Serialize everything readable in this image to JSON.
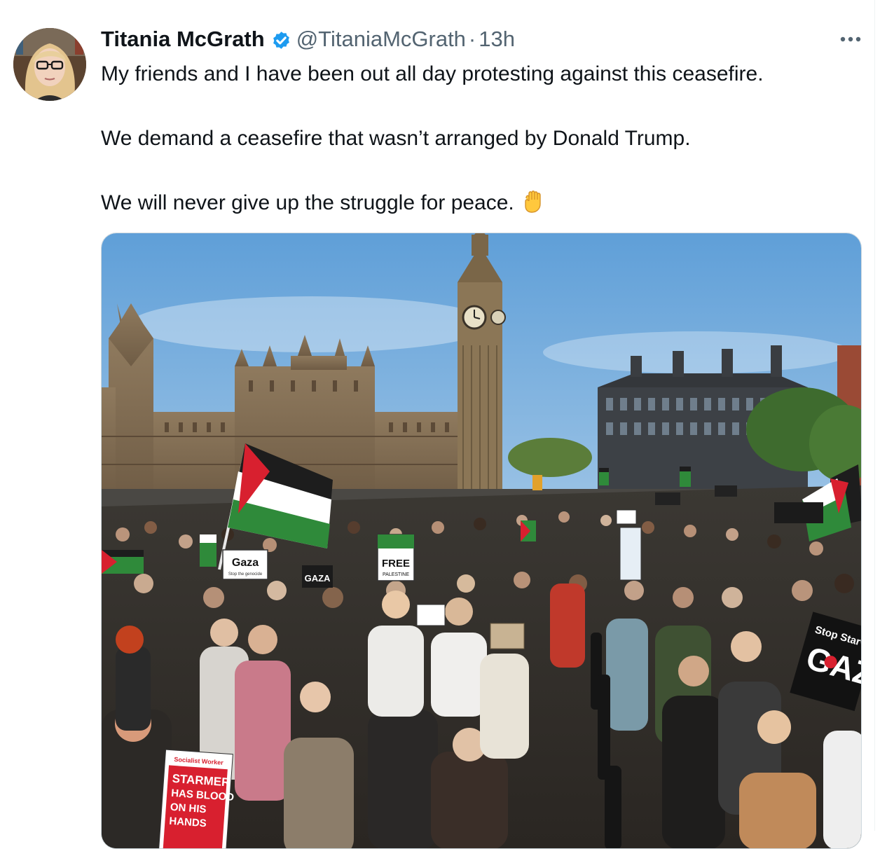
{
  "tweet": {
    "author": {
      "display_name": "Titania McGrath",
      "handle": "@TitaniaMcGrath",
      "verified": true,
      "avatar_icon": "profile-photo"
    },
    "separator": "·",
    "timestamp": "13h",
    "more_icon": "more-horizontal-icon",
    "paragraphs": [
      "My friends and I have been out all day protesting against this ceasefire.",
      "We demand a ceasefire that wasn’t arranged by Donald Trump.",
      "We will never give up the struggle for peace."
    ],
    "trailing_emoji": "raised-fist-emoji",
    "media": {
      "kind": "photo",
      "signs": {
        "gaza_stop": "Gaza",
        "gaza_stop_sub": "Stop the genocide",
        "gaza_small": "GAZA",
        "free": "FREE",
        "palestine": "PALESTINE",
        "stop_starv": "Stop Starv",
        "gaz_big": "GAZ",
        "worker_top": "Socialist Worker",
        "starmer": "STARMER",
        "has_blood": "HAS BLOOD",
        "on_his": "ON HIS",
        "hands": "HANDS"
      }
    }
  },
  "colors": {
    "text_primary": "#0f1419",
    "text_secondary": "#536471",
    "verified_blue": "#1d9bf0",
    "sky": "#9ac3e8",
    "stone": "#8a7358"
  }
}
